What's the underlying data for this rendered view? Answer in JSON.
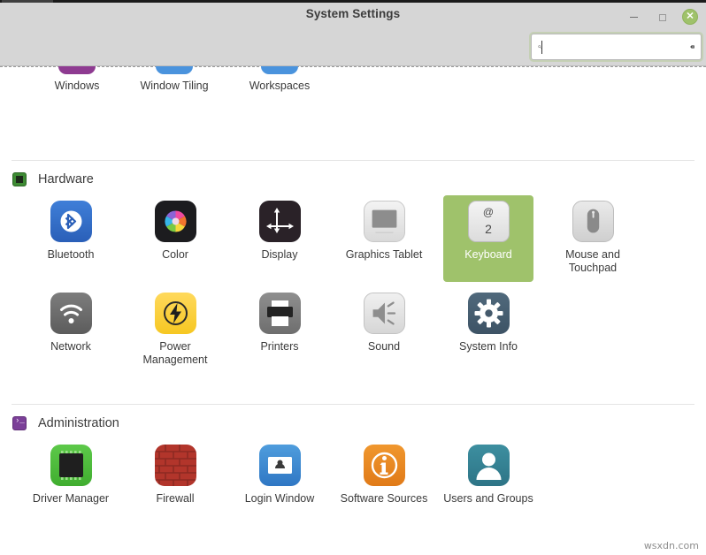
{
  "window": {
    "title": "System Settings",
    "controls": {
      "minimize": "–",
      "maximize": "❐",
      "close": "✕"
    }
  },
  "search": {
    "value": "",
    "placeholder": "",
    "search_icon": "search-icon",
    "clear_icon": "clear-entry-icon"
  },
  "clipped_row": {
    "items": [
      {
        "label": "Windows",
        "icon": "windows-icon"
      },
      {
        "label": "Window Tiling",
        "icon": "window-tiling-icon"
      },
      {
        "label": "Workspaces",
        "icon": "workspaces-icon"
      }
    ]
  },
  "sections": [
    {
      "id": "hardware",
      "title": "Hardware",
      "icon": "chip-icon",
      "items": [
        {
          "label": "Bluetooth",
          "icon": "bluetooth-icon",
          "selected": false
        },
        {
          "label": "Color",
          "icon": "color-icon",
          "selected": false
        },
        {
          "label": "Display",
          "icon": "display-icon",
          "selected": false
        },
        {
          "label": "Graphics Tablet",
          "icon": "graphics-tablet-icon",
          "selected": false
        },
        {
          "label": "Keyboard",
          "icon": "keyboard-icon",
          "selected": true
        },
        {
          "label": "Mouse and Touchpad",
          "icon": "mouse-icon",
          "selected": false
        },
        {
          "label": "Network",
          "icon": "network-icon",
          "selected": false
        },
        {
          "label": "Power Management",
          "icon": "power-icon",
          "selected": false
        },
        {
          "label": "Printers",
          "icon": "printer-icon",
          "selected": false
        },
        {
          "label": "Sound",
          "icon": "sound-icon",
          "selected": false
        },
        {
          "label": "System Info",
          "icon": "system-info-icon",
          "selected": false
        }
      ]
    },
    {
      "id": "administration",
      "title": "Administration",
      "icon": "terminal-icon",
      "items": [
        {
          "label": "Driver Manager",
          "icon": "driver-manager-icon",
          "selected": false
        },
        {
          "label": "Firewall",
          "icon": "firewall-icon",
          "selected": false
        },
        {
          "label": "Login Window",
          "icon": "login-window-icon",
          "selected": false
        },
        {
          "label": "Software Sources",
          "icon": "software-sources-icon",
          "selected": false
        },
        {
          "label": "Users and Groups",
          "icon": "users-groups-icon",
          "selected": false
        }
      ]
    }
  ],
  "keyboard_key": {
    "top": "@",
    "bottom": "2"
  },
  "watermark": "wsxdn.com",
  "colors": {
    "selection": "#9fc26b",
    "headerbar": "#d6d6d6",
    "text": "#3a3a3a"
  }
}
